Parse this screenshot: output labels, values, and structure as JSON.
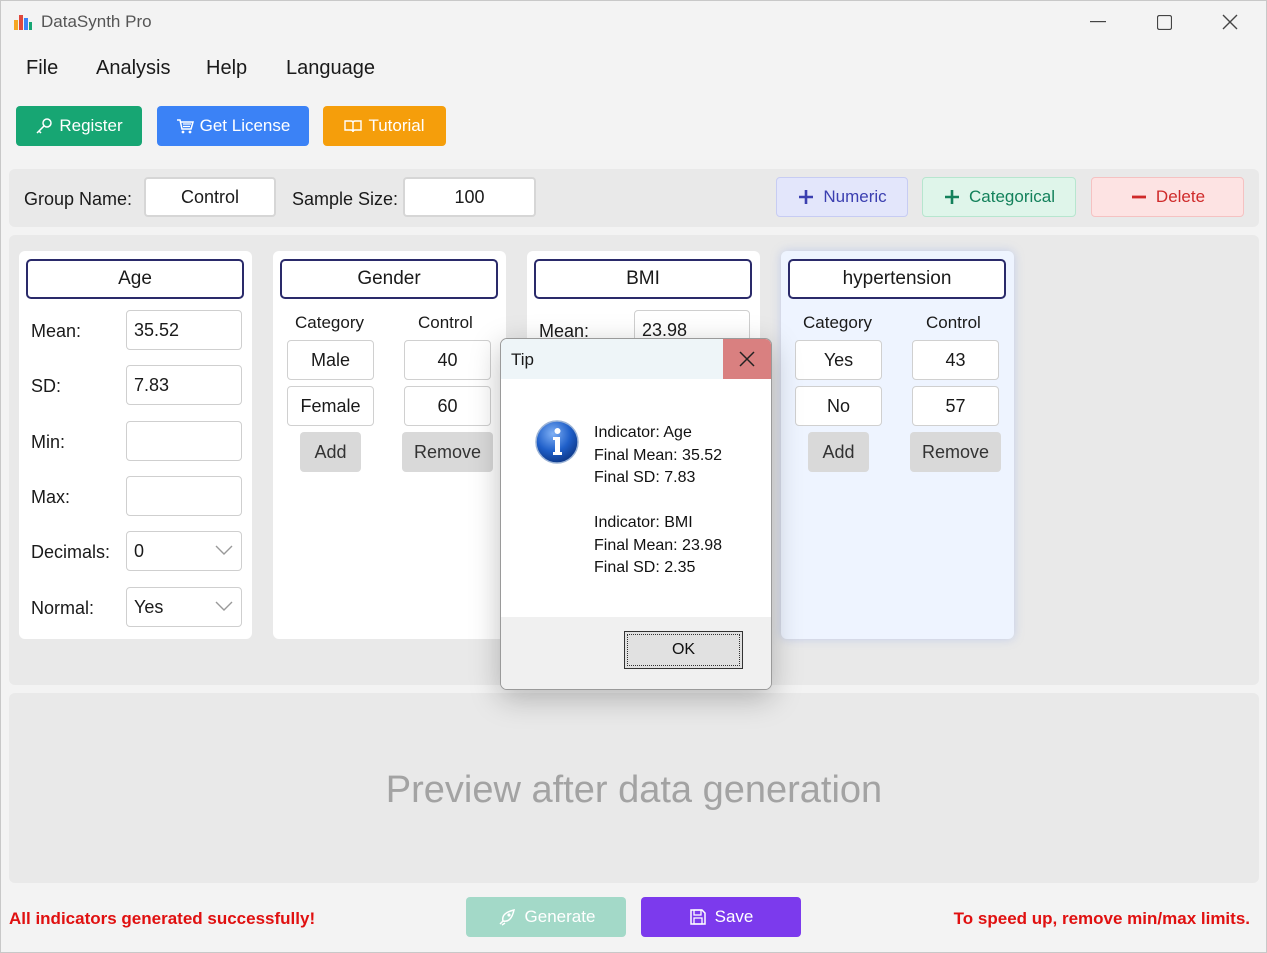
{
  "window": {
    "title": "DataSynth Pro",
    "minimize_glyph": "—",
    "maximize_glyph": "☐",
    "close_glyph": "✕"
  },
  "menu": [
    "File",
    "Analysis",
    "Help",
    "Language"
  ],
  "toolbar": {
    "register": {
      "label": "Register",
      "color": "#17a673",
      "icon": "key-icon"
    },
    "license": {
      "label": "Get License",
      "color": "#3b82f6",
      "icon": "cart-icon"
    },
    "tutorial": {
      "label": "Tutorial",
      "color": "#f59e0b",
      "icon": "book-icon"
    }
  },
  "group": {
    "name_label": "Group Name:",
    "name_value": "Control",
    "size_label": "Sample Size:",
    "size_value": "100",
    "numeric_label": "Numeric",
    "categorical_label": "Categorical",
    "delete_label": "Delete"
  },
  "cards": {
    "age": {
      "title": "Age",
      "mean_label": "Mean:",
      "mean": "35.52",
      "sd_label": "SD:",
      "sd": "7.83",
      "min_label": "Min:",
      "min": "",
      "max_label": "Max:",
      "max": "",
      "decimals_label": "Decimals:",
      "decimals": "0",
      "normal_label": "Normal:",
      "normal": "Yes"
    },
    "gender": {
      "title": "Gender",
      "col_category": "Category",
      "col_control": "Control",
      "rows": [
        {
          "category": "Male",
          "value": "40"
        },
        {
          "category": "Female",
          "value": "60"
        }
      ],
      "add": "Add",
      "remove": "Remove"
    },
    "bmi": {
      "title": "BMI",
      "mean_label": "Mean:",
      "mean": "23.98"
    },
    "hypertension": {
      "title": "hypertension",
      "col_category": "Category",
      "col_control": "Control",
      "rows": [
        {
          "category": "Yes",
          "value": "43"
        },
        {
          "category": "No",
          "value": "57"
        }
      ],
      "add": "Add",
      "remove": "Remove"
    }
  },
  "preview": {
    "text": "Preview after data generation"
  },
  "status": {
    "left": "All indicators generated successfully!",
    "right": "To speed up, remove min/max limits.",
    "color": "#e01010"
  },
  "bottom": {
    "generate": {
      "label": "Generate",
      "color": "#a3d9c8"
    },
    "save": {
      "label": "Save",
      "color": "#7c3aed"
    }
  },
  "dialog": {
    "title": "Tip",
    "icon": "info-icon",
    "lines": [
      "Indicator: Age",
      "Final Mean: 35.52",
      "Final SD: 7.83",
      "",
      "Indicator: BMI",
      "Final Mean: 23.98",
      "Final SD: 2.35"
    ],
    "ok": "OK"
  }
}
